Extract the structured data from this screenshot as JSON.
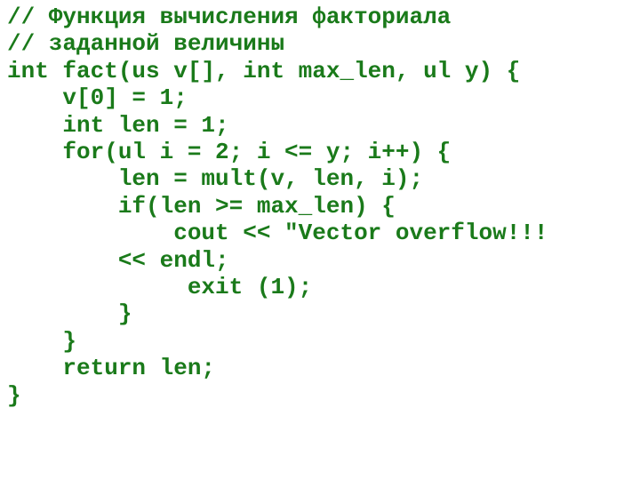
{
  "code": {
    "lines": [
      "// Функция вычисления факториала",
      "// заданной величины",
      "int fact(us v[], int max_len, ul y) {",
      "    v[0] = 1;",
      "    int len = 1;",
      "    for(ul i = 2; i <= y; i++) {",
      "        len = mult(v, len, i);",
      "        if(len >= max_len) {",
      "            cout << \"Vector overflow!!!",
      "        << endl;",
      "             exit (1);",
      "        }",
      "    }",
      "    return len;",
      "}"
    ]
  }
}
